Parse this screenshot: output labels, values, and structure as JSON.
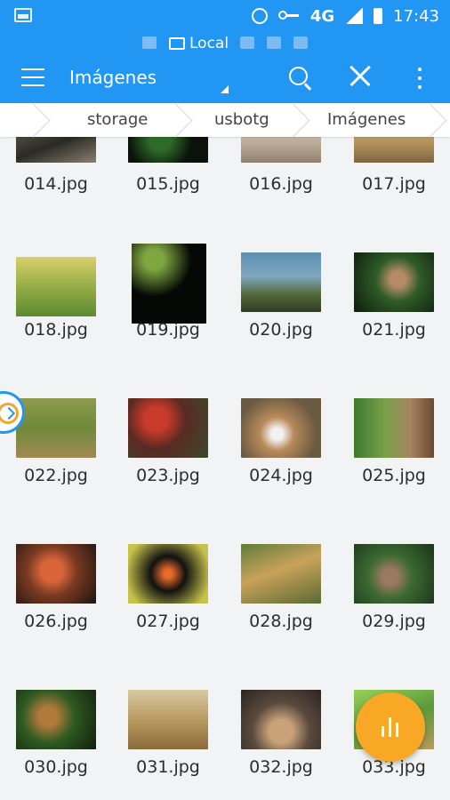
{
  "status_bar": {
    "network": "4G",
    "time": "17:43"
  },
  "tabs": {
    "local_label": "Local"
  },
  "toolbar": {
    "title": "Imágenes"
  },
  "breadcrumb": {
    "items": [
      "storage",
      "usbotg",
      "Imágenes"
    ]
  },
  "files": [
    {
      "name": "014.jpg"
    },
    {
      "name": "015.jpg"
    },
    {
      "name": "016.jpg"
    },
    {
      "name": "017.jpg"
    },
    {
      "name": "018.jpg"
    },
    {
      "name": "019.jpg"
    },
    {
      "name": "020.jpg"
    },
    {
      "name": "021.jpg"
    },
    {
      "name": "022.jpg"
    },
    {
      "name": "023.jpg"
    },
    {
      "name": "024.jpg"
    },
    {
      "name": "025.jpg"
    },
    {
      "name": "026.jpg"
    },
    {
      "name": "027.jpg"
    },
    {
      "name": "028.jpg"
    },
    {
      "name": "029.jpg"
    },
    {
      "name": "030.jpg"
    },
    {
      "name": "031.jpg"
    },
    {
      "name": "032.jpg"
    },
    {
      "name": "033.jpg"
    }
  ],
  "colors": {
    "accent": "#2196f3",
    "fab": "#f9a825",
    "background": "#f1f3f4"
  },
  "icons": {
    "status": [
      "image-icon",
      "alarm-icon",
      "vpn-key-icon",
      "signal-icon",
      "battery-icon"
    ],
    "tabs": [
      "home-icon",
      "local-storage-icon",
      "chat-icon",
      "printer-icon",
      "monitor-icon"
    ],
    "toolbar": [
      "menu-icon",
      "search-icon",
      "close-icon",
      "more-vert-icon"
    ],
    "fab": "bar-chart-icon",
    "side": "side-panel-handle-icon"
  }
}
